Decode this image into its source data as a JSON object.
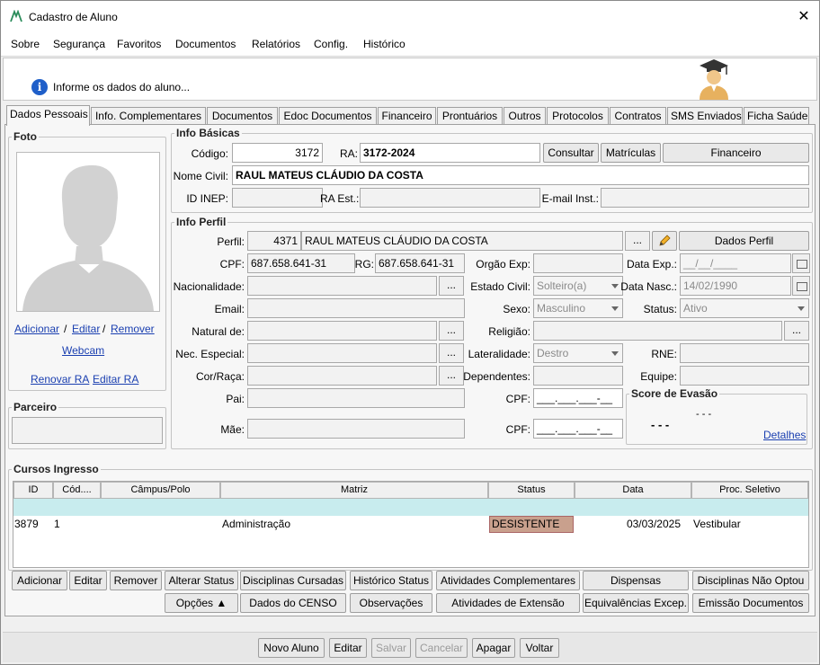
{
  "window": {
    "title": "Cadastro de Aluno",
    "close_glyph": "✕"
  },
  "menu": [
    "Sobre",
    "Segurança",
    "Favoritos",
    "Documentos",
    "Relatórios",
    "Config.",
    "Histórico"
  ],
  "info_message": "Informe os dados do aluno...",
  "tabs": [
    "Dados Pessoais",
    "Info. Complementares",
    "Documentos",
    "Edoc Documentos",
    "Financeiro",
    "Prontuários",
    "Outros",
    "Protocolos",
    "Contratos",
    "SMS Enviados",
    "Ficha Saúde"
  ],
  "foto": {
    "legend": "Foto",
    "add": "Adicionar",
    "sep1": "/",
    "edit": "Editar",
    "sep2": "/",
    "remove": "Remover",
    "webcam": "Webcam",
    "renew_ra": "Renovar RA",
    "edit_ra": "Editar RA"
  },
  "parceiro": {
    "legend": "Parceiro",
    "value": ""
  },
  "info_basicas": {
    "legend": "Info Básicas",
    "codigo_label": "Código:",
    "codigo": "3172",
    "ra_label": "RA:",
    "ra": "3172-2024",
    "consultar": "Consultar",
    "matriculas": "Matrículas",
    "financeiro": "Financeiro",
    "nome_label": "Nome Civil:",
    "nome": "RAUL MATEUS CLÁUDIO DA COSTA",
    "inep_label": "ID INEP:",
    "inep": "",
    "ra_est_label": "RA Est.:",
    "ra_est": "",
    "email_inst_label": "E-mail Inst.:",
    "email_inst": ""
  },
  "info_perfil": {
    "legend": "Info Perfil",
    "perfil_label": "Perfil:",
    "perfil_id": "4371",
    "perfil_nome": "RAUL MATEUS CLÁUDIO DA COSTA",
    "dots": "...",
    "dados_perfil": "Dados Perfil",
    "cpf_label": "CPF:",
    "cpf": "687.658.641-31",
    "rg_label": "RG:",
    "rg": "687.658.641-31",
    "orgao_label": "Orgão Exp:",
    "orgao": "",
    "data_exp_label": "Data Exp.:",
    "data_exp": "__/__/____",
    "nac_label": "Nacionalidade:",
    "nac": "",
    "estado_civil_label": "Estado Civil:",
    "estado_civil": "Solteiro(a)",
    "data_nasc_label": "Data Nasc.:",
    "data_nasc": "14/02/1990",
    "email_label": "Email:",
    "email": "",
    "sexo_label": "Sexo:",
    "sexo": "Masculino",
    "status_label": "Status:",
    "status": "Ativo",
    "natural_label": "Natural de:",
    "natural": "",
    "religiao_label": "Religião:",
    "religiao": "",
    "nec_label": "Nec. Especial:",
    "nec": "",
    "lateralidade_label": "Lateralidade:",
    "lateralidade": "Destro",
    "rne_label": "RNE:",
    "rne": "",
    "cor_label": "Cor/Raça:",
    "cor": "",
    "dependentes_label": "Dependentes:",
    "dependentes": "",
    "equipe_label": "Equipe:",
    "equipe": "",
    "pai_label": "Pai:",
    "pai": "",
    "cpf_pai_label": "CPF:",
    "cpf_pai": "___.___.___-__",
    "mae_label": "Mãe:",
    "mae": "",
    "cpf_mae_label": "CPF:",
    "cpf_mae": "___.___.___-__"
  },
  "score": {
    "legend": "Score de Evasão",
    "value_small": "- - -",
    "value_big": "- - -",
    "detalhes": "Detalhes"
  },
  "cursos": {
    "legend": "Cursos Ingresso",
    "columns": [
      "ID",
      "Cód....",
      "Câmpus/Polo",
      "Matriz",
      "Status",
      "Data",
      "Proc. Seletivo"
    ],
    "rows": [
      {
        "id": "3879",
        "cod": "1",
        "campus": "",
        "matriz": "Administração",
        "status": "DESISTENTE",
        "data": "03/03/2025",
        "proc": "Vestibular"
      }
    ],
    "status_color": "#c9a08d",
    "row_color": "#c8ecee"
  },
  "actions_row1": [
    "Adicionar",
    "Editar",
    "Remover",
    "Alterar Status",
    "Disciplinas Cursadas",
    "Histórico Status",
    "Atividades Complementares",
    "Dispensas",
    "Disciplinas Não Optou"
  ],
  "actions_row2": [
    "Opções ▲",
    "Dados do CENSO",
    "Observações",
    "Atividades de Extensão",
    "Equivalências Excep.",
    "Emissão Documentos"
  ],
  "bottom": [
    "Novo Aluno",
    "Editar",
    "Salvar",
    "Cancelar",
    "Apagar",
    "Voltar"
  ]
}
